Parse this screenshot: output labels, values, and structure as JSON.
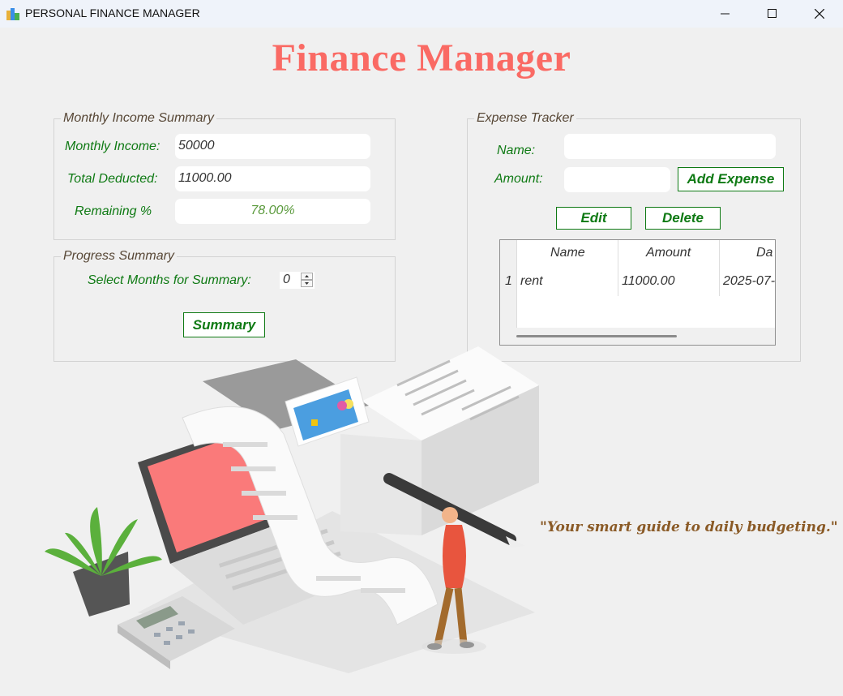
{
  "window": {
    "title": "PERSONAL FINANCE MANAGER"
  },
  "heading": "Finance Manager",
  "income": {
    "title": "Monthly Income Summary",
    "monthly_income_label": "Monthly Income:",
    "monthly_income_value": "50000",
    "total_deducted_label": "Total Deducted:",
    "total_deducted_value": "11000.00",
    "remaining_label": "Remaining %",
    "remaining_value": "78.00%"
  },
  "progress": {
    "title": "Progress Summary",
    "months_label": "Select Months for Summary:",
    "months_value": "0",
    "summary_button": "Summary"
  },
  "expense": {
    "title": "Expense Tracker",
    "name_label": "Name:",
    "name_value": "",
    "amount_label": "Amount:",
    "amount_value": "",
    "add_button": "Add Expense",
    "edit_button": "Edit",
    "delete_button": "Delete",
    "table": {
      "headers": [
        "Name",
        "Amount",
        "Da"
      ],
      "rows": [
        {
          "index": "1",
          "name": "rent",
          "amount": "11000.00",
          "date": "2025-07-"
        }
      ]
    }
  },
  "quote": "\"Your smart guide to daily budgeting.\"",
  "colors": {
    "heading": "#fa6a64",
    "accent_green": "#0f7a14",
    "quote": "#8a5a26"
  }
}
